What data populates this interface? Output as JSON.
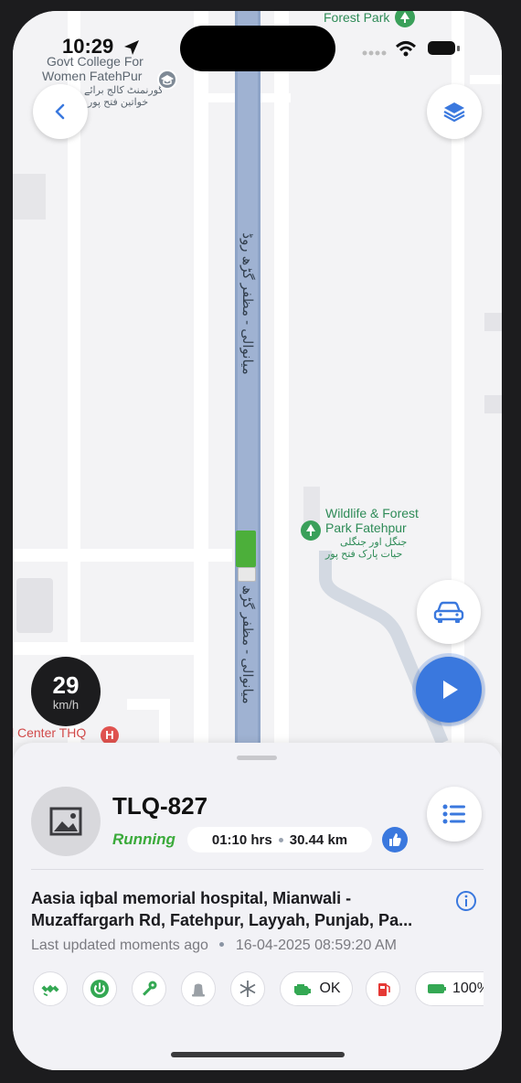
{
  "status_bar": {
    "time": "10:29"
  },
  "map": {
    "labels": {
      "forest_park": "Forest Park",
      "college_en_1": "Govt College For",
      "college_en_2": "Women FatehPur",
      "college_ur_1": "گورنمنٹ کالج برائے",
      "college_ur_2": "خواتین فتح پور",
      "wildlife_en_1": "Wildlife & Forest",
      "wildlife_en_2": "Park Fatehpur",
      "wildlife_ur_1": "جنگل اور جنگلی",
      "wildlife_ur_2": "حیات پارک فتح پور",
      "road_ur": "میانوالی - مظفر گڑھ روڈ",
      "health_center": "l Center THQ"
    }
  },
  "speed": {
    "value": "29",
    "unit": "km/h"
  },
  "vehicle": {
    "plate": "TLQ-827",
    "status": "Running",
    "duration": "01:10 hrs",
    "distance": "30.44 km",
    "address_line1": "Aasia iqbal memorial hospital, Mianwali -",
    "address_line2": "Muzaffargarh Rd, Fatehpur, Layyah, Punjab, Pa...",
    "last_updated": "Last updated moments ago",
    "timestamp": "16-04-2025 08:59:20 AM"
  },
  "chips": {
    "engine_status": "OK",
    "battery": "100%"
  },
  "colors": {
    "accent": "#3a78de",
    "running": "#3aaa3a",
    "chip_green": "#34a853",
    "chip_red": "#e53935"
  }
}
